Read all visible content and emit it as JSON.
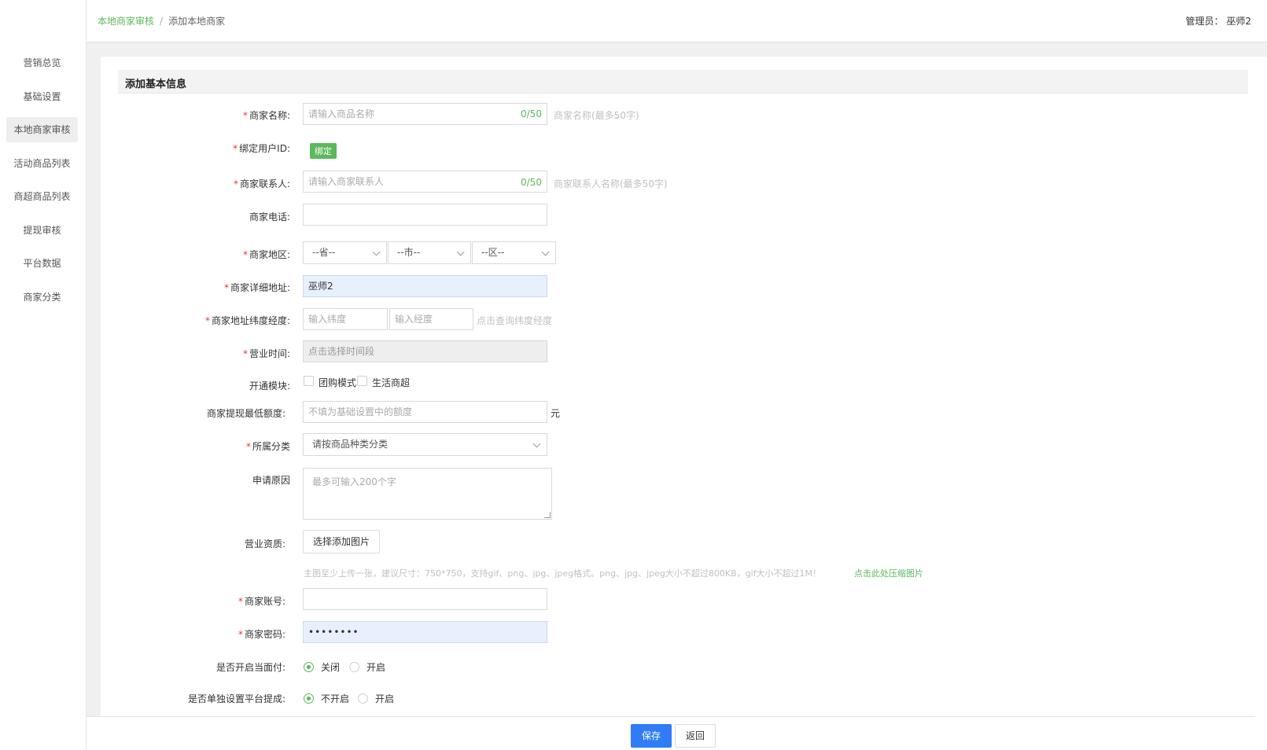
{
  "sidebar": {
    "items": [
      {
        "label": "营销总览"
      },
      {
        "label": "基础设置"
      },
      {
        "label": "本地商家审核",
        "active": true
      },
      {
        "label": "活动商品列表"
      },
      {
        "label": "商超商品列表"
      },
      {
        "label": "提现审核"
      },
      {
        "label": "平台数据"
      },
      {
        "label": "商家分类"
      }
    ]
  },
  "header": {
    "breadcrumb": {
      "parent": "本地商家审核",
      "separator": "/",
      "current": "添加本地商家"
    },
    "admin_text": "管理员：  巫师2"
  },
  "section": {
    "title": "添加基本信息"
  },
  "form": {
    "required_mark": "*",
    "merchant_name": {
      "label": "商家名称:",
      "placeholder": "请输入商品名称",
      "counter": "0/50",
      "hint": "商家名称(最多50字)"
    },
    "bind_user": {
      "label": "绑定用户ID:",
      "button": "绑定"
    },
    "contact": {
      "label": "商家联系人:",
      "placeholder": "请输入商家联系人",
      "counter": "0/50",
      "hint": "商家联系人名称(最多50字)"
    },
    "phone": {
      "label": "商家电话:",
      "value": ""
    },
    "region": {
      "label": "商家地区:",
      "province": "--省--",
      "city": "--市--",
      "district": "--区--"
    },
    "address": {
      "label": "商家详细地址:",
      "value": "巫师2"
    },
    "latlng": {
      "label": "商家地址纬度经度:",
      "lat_placeholder": "输入纬度",
      "lng_placeholder": "输入经度",
      "link": "点击查询纬度经度"
    },
    "hours": {
      "label": "营业时间:",
      "placeholder": "点击选择时间段"
    },
    "modules": {
      "label": "开通模块:",
      "options": [
        "团购模式",
        "生活商超"
      ]
    },
    "min_withdraw": {
      "label": "商家提现最低额度:",
      "placeholder": "不填为基础设置中的额度",
      "unit": "元"
    },
    "category": {
      "label": "所属分类",
      "value": "请按商品种类分类"
    },
    "reason": {
      "label": "申请原因",
      "placeholder": "最多可输入200个字"
    },
    "license": {
      "label": "营业资质:",
      "button": "选择添加图片",
      "hint": "主图至少上传一张，建议尺寸：750*750，支持gif、png、jpg、jpeg格式。png、jpg、jpeg大小不超过800KB，gif大小不超过1M！",
      "compress_link": "点击此处压缩图片"
    },
    "account": {
      "label": "商家账号:",
      "value": ""
    },
    "password": {
      "label": "商家密码:",
      "value": "••••••••"
    },
    "face_pay": {
      "label": "是否开启当面付:",
      "options": [
        "关闭",
        "开启"
      ],
      "selected": "关闭"
    },
    "commission": {
      "label": "是否单独设置平台提成:",
      "options": [
        "不开启",
        "开启"
      ],
      "selected": "不开启"
    }
  },
  "footer": {
    "save": "保存",
    "back": "返回"
  },
  "colors": {
    "accent_green": "#5cb85c",
    "primary_blue": "#2f7cf6",
    "required_red": "#e53935"
  }
}
